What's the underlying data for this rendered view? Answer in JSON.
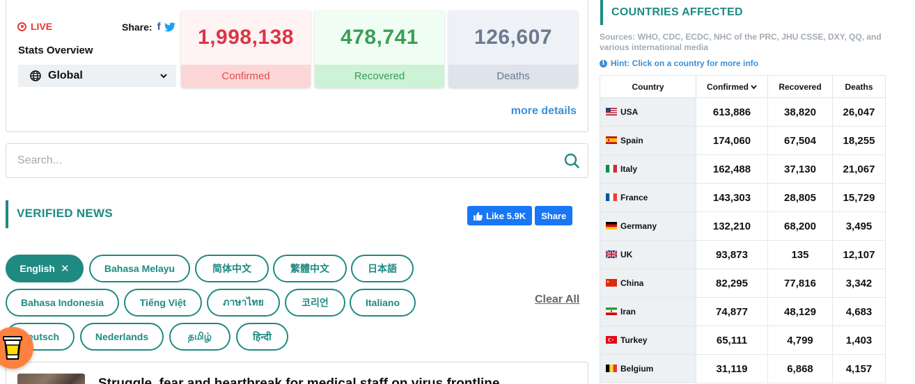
{
  "stats": {
    "live_label": "LIVE",
    "share_label": "Share:",
    "title": "Stats Overview",
    "region": "Global",
    "confirmed": {
      "value": "1,998,138",
      "label": "Confirmed"
    },
    "recovered": {
      "value": "478,741",
      "label": "Recovered"
    },
    "deaths": {
      "value": "126,607",
      "label": "Deaths"
    },
    "more_details": "more details"
  },
  "search": {
    "placeholder": "Search...",
    "value": ""
  },
  "news": {
    "title": "VERIFIED NEWS",
    "fb_like": "Like 5.9K",
    "fb_share": "Share",
    "languages": [
      "English",
      "Bahasa Melayu",
      "简体中文",
      "繁體中文",
      "日本語",
      "Bahasa Indonesia",
      "Tiếng Việt",
      "ภาษาไทย",
      "코리언",
      "Italiano",
      "Deutsch",
      "Nederlands",
      "தமிழ்",
      "हिन्दी"
    ],
    "active_language": "English",
    "clear_all": "Clear All",
    "headline": "Struggle, fear and heartbreak for medical staff on virus frontline"
  },
  "countries": {
    "title": "COUNTRIES AFFECTED",
    "sources": "Sources: WHO, CDC, ECDC, NHC of the PRC, JHU CSSE, DXY, QQ, and various international media",
    "hint": "Hint: Click on a country for more info",
    "headers": {
      "country": "Country",
      "confirmed": "Confirmed",
      "recovered": "Recovered",
      "deaths": "Deaths"
    },
    "rows": [
      {
        "name": "USA",
        "flag": "flag-usa-icon",
        "confirmed": "613,886",
        "recovered": "38,820",
        "deaths": "26,047"
      },
      {
        "name": "Spain",
        "flag": "flag-spain-icon",
        "confirmed": "174,060",
        "recovered": "67,504",
        "deaths": "18,255"
      },
      {
        "name": "Italy",
        "flag": "flag-italy-icon",
        "confirmed": "162,488",
        "recovered": "37,130",
        "deaths": "21,067"
      },
      {
        "name": "France",
        "flag": "flag-france-icon",
        "confirmed": "143,303",
        "recovered": "28,805",
        "deaths": "15,729"
      },
      {
        "name": "Germany",
        "flag": "flag-germany-icon",
        "confirmed": "132,210",
        "recovered": "68,200",
        "deaths": "3,495"
      },
      {
        "name": "UK",
        "flag": "flag-uk-icon",
        "confirmed": "93,873",
        "recovered": "135",
        "deaths": "12,107"
      },
      {
        "name": "China",
        "flag": "flag-china-icon",
        "confirmed": "82,295",
        "recovered": "77,816",
        "deaths": "3,342"
      },
      {
        "name": "Iran",
        "flag": "flag-iran-icon",
        "confirmed": "74,877",
        "recovered": "48,129",
        "deaths": "4,683"
      },
      {
        "name": "Turkey",
        "flag": "flag-turkey-icon",
        "confirmed": "65,111",
        "recovered": "4,799",
        "deaths": "1,403"
      },
      {
        "name": "Belgium",
        "flag": "flag-belgium-icon",
        "confirmed": "31,119",
        "recovered": "6,868",
        "deaths": "4,157"
      }
    ]
  },
  "colors": {
    "accent": "#1e8a82",
    "confirmed": "#dc3545",
    "recovered": "#3a9f56",
    "deaths": "#6b7b8f",
    "link": "#3b8fd6",
    "facebook": "#1877f2"
  }
}
